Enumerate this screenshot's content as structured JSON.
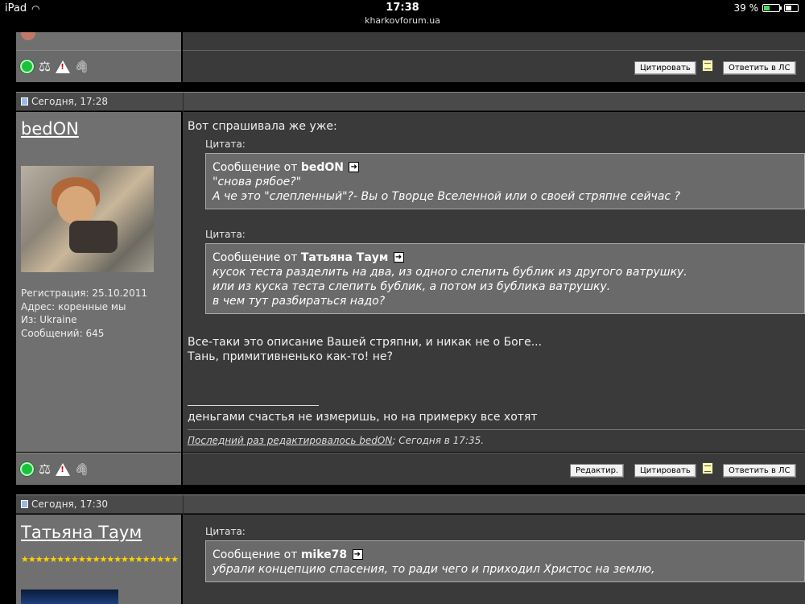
{
  "status_bar": {
    "device": "iPad",
    "time": "17:38",
    "url": "kharkovforum.ua",
    "battery": "39 %",
    "battery_level": 0.39
  },
  "colors": {
    "online_green": "#19c23a",
    "user_panel": "#707070",
    "content_panel": "#3a3a3a"
  },
  "post_top": {
    "buttons": {
      "quote": "Цитировать",
      "reply_pm": "Ответить в ЛС"
    }
  },
  "post1": {
    "date": "Сегодня, 17:28",
    "username": "bedON",
    "user_info": {
      "registered": "Регистрация: 25.10.2011",
      "address": "Адрес: коренные мы",
      "from": "Из: Ukraine",
      "messages": "Сообщений: 645"
    },
    "intro": "Вот спрашивала же уже:",
    "quotes": [
      {
        "label": "Цитата:",
        "from_prefix": "Сообщение от",
        "author": "bedON",
        "lines": [
          "\"снова рябое?\"",
          "А че это \"слепленный\"?- Вы о Творце Вселенной или о своей стряпне сейчас ?"
        ]
      },
      {
        "label": "Цитата:",
        "from_prefix": "Сообщение от",
        "author": "Татьяна Таум",
        "lines": [
          "кусок теста разделить на два, из одного слепить бублик из другого ватрушку.",
          "или из куска теста слепить бублик, а потом из бублика ватрушку.",
          "в чем тут разбираться надо?"
        ]
      }
    ],
    "body": [
      "Все-таки это описание Вашей стряпни, и никак не о Боге...",
      "Тань, примитивненько как-то! не?"
    ],
    "signature": "деньгами счастья не измеришь, но на примерку все хотят",
    "edited": {
      "prefix": "Последний раз редактировалось bedON",
      "suffix": "; Сегодня в 17:35."
    },
    "buttons": {
      "edit": "Редактир.",
      "quote": "Цитировать",
      "reply_pm": "Ответить в ЛС"
    }
  },
  "post2": {
    "date": "Сегодня, 17:30",
    "username": "Татьяна Таум",
    "stars": "★★★★★★★★★★★★★★★★★★★★★★",
    "quote": {
      "label": "Цитата:",
      "from_prefix": "Сообщение от",
      "author": "mike78",
      "lines": [
        "убрали концепцию спасения, то ради чего и приходил Христос на землю,"
      ]
    }
  }
}
